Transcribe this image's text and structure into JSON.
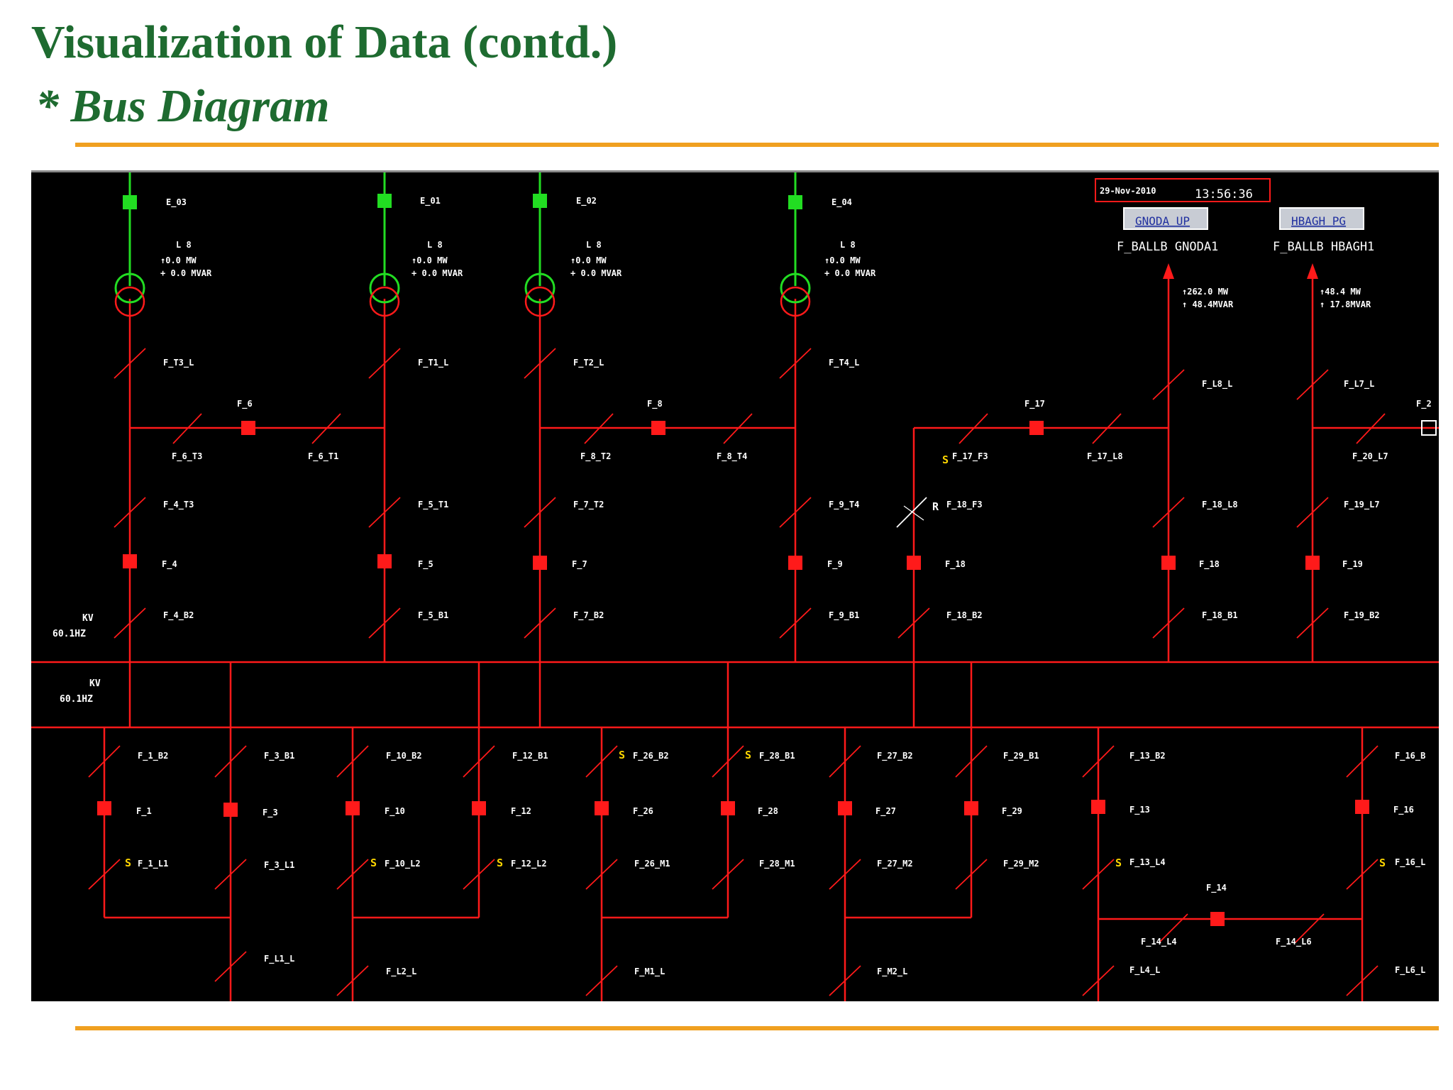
{
  "slide": {
    "title": "Visualization of Data (contd.)",
    "subtitle": "* Bus Diagram"
  },
  "scada": {
    "date": "29-Nov-2010",
    "time": "13:56:36",
    "buttons": [
      {
        "label": "GNODA UP",
        "feeder": "F_BALLB GNODA1",
        "mw": "↑262.0  MW",
        "mvar": "↑   48.4MVAR"
      },
      {
        "label": "HBAGH PG",
        "feeder": "F_BALLB HBAGH1",
        "mw": "↑48.4   MW",
        "mvar": "↑    17.8MVAR"
      }
    ],
    "sources": [
      {
        "name": "E_03",
        "l": "L    8",
        "mw": "↑0.0     MW",
        "mvar": "+    0.0 MVAR"
      },
      {
        "name": "E_01",
        "l": "L    8",
        "mw": "↑0.0     MW",
        "mvar": "+    0.0 MVAR"
      },
      {
        "name": "E_02",
        "l": "L    8",
        "mw": "↑0.0     MW",
        "mvar": "+    0.0 MVAR"
      },
      {
        "name": "E_04",
        "l": "L    8",
        "mw": "↑0.0     MW",
        "mvar": "+    0.0 MVAR"
      }
    ],
    "kv_labels": [
      {
        "kv": "KV",
        "hz": "60.1HZ"
      },
      {
        "kv": "KV",
        "hz": "60.1HZ"
      }
    ],
    "labels": {
      "f_t3_l": "F_T3_L",
      "f_t1_l": "F_T1_L",
      "f_t2_l": "F_T2_L",
      "f_t4_l": "F_T4_L",
      "f_l8_l": "F_L8_L",
      "f_l7_l": "F_L7_L",
      "f_6": "F_6",
      "f_8top": "F_8",
      "f_17": "F_17",
      "f_2x": "F_2",
      "f_6_t3": "F_6_T3",
      "f_6_t1": "F_6_T1",
      "f_8_t2": "F_8_T2",
      "f_8_t4": "F_8_T4",
      "f_17_f3": "F_17_F3",
      "f_17_l8": "F_17_L8",
      "f_20_l7": "F_20_L7",
      "f_4_t3": "F_4_T3",
      "f_5_t1": "F_5_T1",
      "f_7_t2": "F_7_T2",
      "f_9_t4": "F_9_T4",
      "f_18_f3": "F_18_F3",
      "f_18_l8": "F_18_L8",
      "f_19_l7": "F_19_L7",
      "f_4": "F_4",
      "f_5": "F_5",
      "f_7": "F_7",
      "f_9": "F_9",
      "f_18": "F_18",
      "f_18b": "F_18",
      "f_19": "F_19",
      "f_4_b2": "F_4_B2",
      "f_5_b1": "F_5_B1",
      "f_7_b2": "F_7_B2",
      "f_9_b1": "F_9_B1",
      "f_18_b2": "F_18_B2",
      "f_18_b1": "F_18_B1",
      "f_19_b2": "F_19_B2",
      "f_1_b2": "F_1_B2",
      "f_3_b1": "F_3_B1",
      "f_10_b2": "F_10_B2",
      "f_12_b1": "F_12_B1",
      "f_26_b2": "F_26_B2",
      "f_28_b1": "F_28_B1",
      "f_27_b2": "F_27_B2",
      "f_29_b1": "F_29_B1",
      "f_13_b2": "F_13_B2",
      "f_16_b": "F_16_B",
      "f_1": "F_1",
      "f_3": "F_3",
      "f_10": "F_10",
      "f_12": "F_12",
      "f_26": "F_26",
      "f_28": "F_28",
      "f_27": "F_27",
      "f_29": "F_29",
      "f_13": "F_13",
      "f_16": "F_16",
      "f_1_l1": "F_1_L1",
      "f_3_l1": "F_3_L1",
      "f_10_l2": "F_10_L2",
      "f_12_l2": "F_12_L2",
      "f_26_m1": "F_26_M1",
      "f_28_m1": "F_28_M1",
      "f_27_m2": "F_27_M2",
      "f_29_m2": "F_29_M2",
      "f_13_l4": "F_13_L4",
      "f_16_l": "F_16_L",
      "f_14": "F_14",
      "f_14_l4": "F_14_L4",
      "f_14_l6": "F_14_L6",
      "f_l1_l": "F_L1_L",
      "f_l2_l": "F_L2_L",
      "f_m1_l": "F_M1_L",
      "f_m2_l": "F_M2_L",
      "f_l4_l": "F_L4_L",
      "f_l6_l": "F_L6_L",
      "s": "S",
      "r": "R"
    }
  }
}
